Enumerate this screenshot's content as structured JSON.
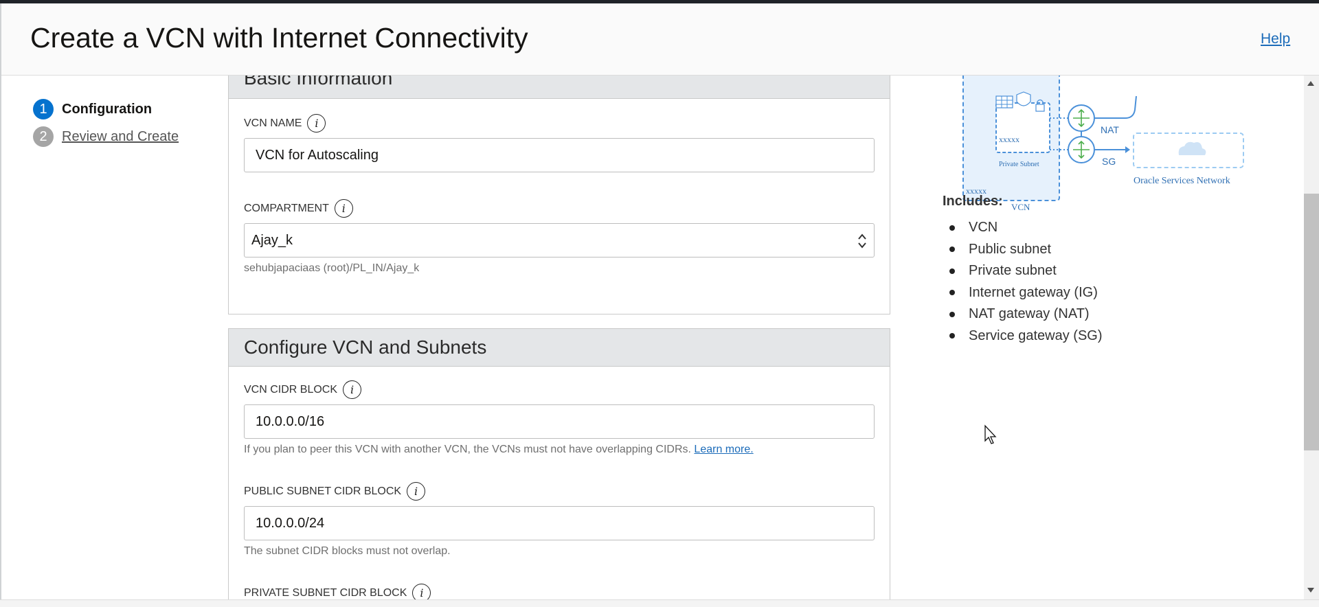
{
  "header": {
    "title": "Create a VCN with Internet Connectivity",
    "help_label": "Help"
  },
  "steps": [
    {
      "number": "1",
      "label": "Configuration"
    },
    {
      "number": "2",
      "label": "Review and Create"
    }
  ],
  "basic_info": {
    "title": "Basic Information",
    "vcn_name_label": "VCN NAME",
    "vcn_name_value": "VCN for Autoscaling",
    "compartment_label": "COMPARTMENT",
    "compartment_value": "Ajay_k",
    "compartment_path": "sehubjapaciaas (root)/PL_IN/Ajay_k"
  },
  "configure": {
    "title": "Configure VCN and Subnets",
    "vcn_cidr_label": "VCN CIDR BLOCK",
    "vcn_cidr_value": "10.0.0.0/16",
    "vcn_cidr_hint": "If you plan to peer this VCN with another VCN, the VCNs must not have overlapping CIDRs.",
    "learn_more": "Learn more.",
    "public_cidr_label": "PUBLIC SUBNET CIDR BLOCK",
    "public_cidr_value": "10.0.0.0/24",
    "public_cidr_hint": "The subnet CIDR blocks must not overlap.",
    "private_cidr_label": "PRIVATE SUBNET CIDR BLOCK"
  },
  "diagram": {
    "nat_label": "NAT",
    "sg_label": "SG",
    "subnet_cidr": "xxxxx",
    "private_subnet_label": "Private Subnet",
    "vcn_cidr": "xxxxx",
    "vcn_label": "VCN",
    "osn_label": "Oracle Services Network"
  },
  "includes": {
    "title": "Includes:",
    "items": [
      "VCN",
      "Public subnet",
      "Private subnet",
      "Internet gateway (IG)",
      "NAT gateway (NAT)",
      "Service gateway (SG)"
    ]
  }
}
